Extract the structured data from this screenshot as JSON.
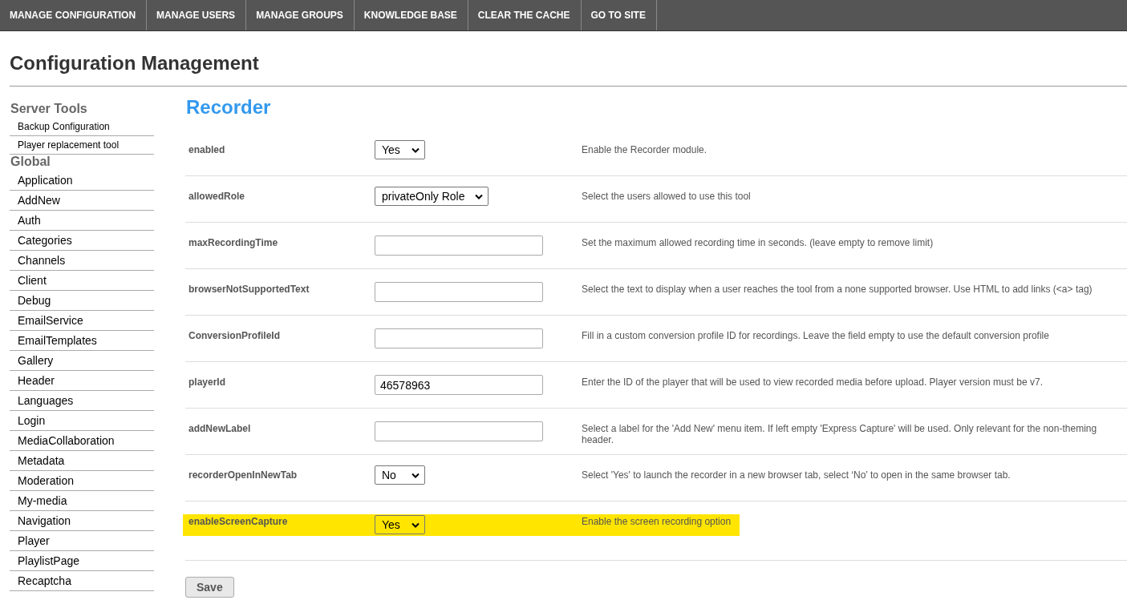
{
  "nav": [
    "MANAGE CONFIGURATION",
    "MANAGE USERS",
    "MANAGE GROUPS",
    "KNOWLEDGE BASE",
    "CLEAR THE CACHE",
    "GO TO SITE"
  ],
  "page_title": "Configuration Management",
  "sidebar": [
    {
      "heading": "Server Tools",
      "kind": "tools",
      "items": [
        "Backup Configuration",
        "Player replacement tool"
      ]
    },
    {
      "heading": "Global",
      "kind": "modules",
      "items": [
        "Application",
        "AddNew",
        "Auth",
        "Categories",
        "Channels",
        "Client",
        "Debug",
        "EmailService",
        "EmailTemplates",
        "Gallery",
        "Header",
        "Languages",
        "Login",
        "MediaCollaboration",
        "Metadata",
        "Moderation",
        "My-media",
        "Navigation",
        "Player",
        "PlaylistPage",
        "Recaptcha"
      ]
    }
  ],
  "section_title": "Recorder",
  "settings": [
    {
      "name": "enabled",
      "kind": "select",
      "value": "Yes",
      "description": "Enable the Recorder module.",
      "highlighted": false
    },
    {
      "name": "allowedRole",
      "kind": "select",
      "value": "privateOnly Role",
      "description": "Select the users allowed to use this tool",
      "highlighted": false
    },
    {
      "name": "maxRecordingTime",
      "kind": "text",
      "description": "Set the maximum allowed recording time in seconds. (leave empty to remove limit)",
      "highlighted": false
    },
    {
      "name": "browserNotSupportedText",
      "kind": "text",
      "description": "Select the text to display when a user reaches the tool from a none supported browser. Use HTML to add links (<a> tag)",
      "highlighted": false
    },
    {
      "name": "ConversionProfileId",
      "kind": "text",
      "description": "Fill in a custom conversion profile ID for recordings. Leave the field empty to use the default conversion profile",
      "highlighted": false
    },
    {
      "name": "playerId",
      "kind": "text",
      "value": "46578963",
      "description": "Enter the ID of the player that will be used to view recorded media before upload. Player version must be v7.",
      "highlighted": false
    },
    {
      "name": "addNewLabel",
      "kind": "text",
      "description": "Select a label for the 'Add New' menu item. If left empty 'Express Capture' will be used. Only relevant for the non-theming header.",
      "highlighted": false
    },
    {
      "name": "recorderOpenInNewTab",
      "kind": "select",
      "value": "No",
      "description": "Select 'Yes' to launch the recorder in a new browser tab, select ‘No’ to open in the same browser tab.",
      "highlighted": false
    },
    {
      "name": "enableScreenCapture",
      "kind": "select",
      "value": "Yes",
      "description": "Enable the screen recording option",
      "highlighted": true
    }
  ],
  "save_button": "Save"
}
